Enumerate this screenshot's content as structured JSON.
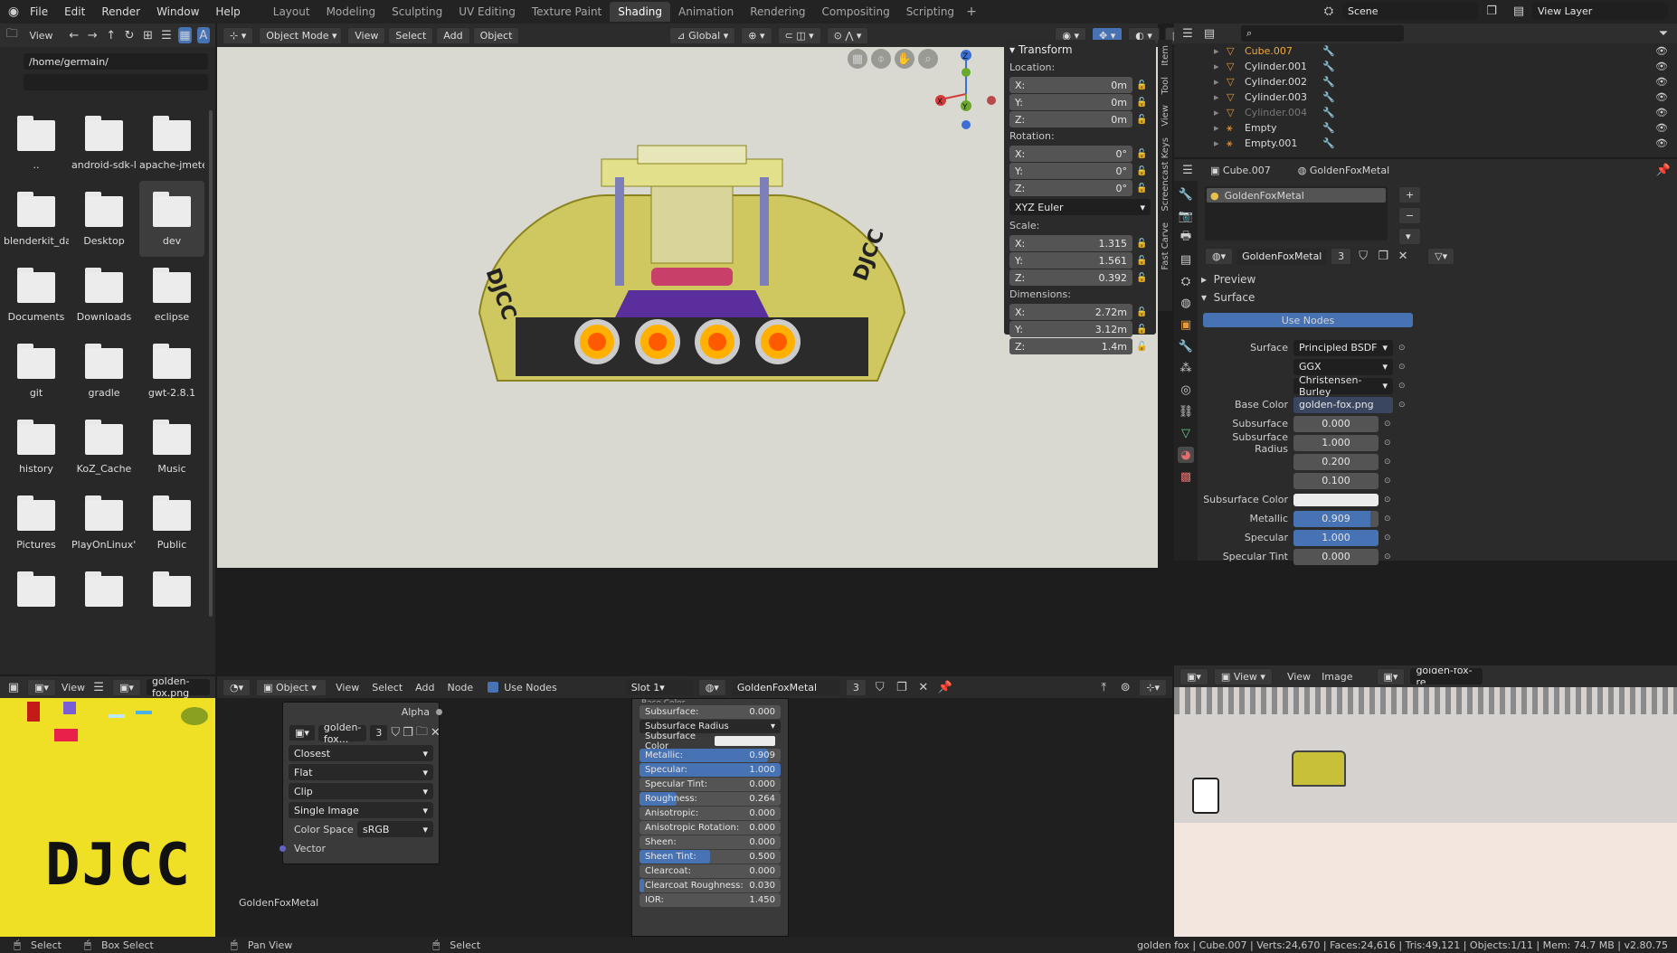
{
  "topbar": {
    "menus": [
      "File",
      "Edit",
      "Render",
      "Window",
      "Help"
    ],
    "workspaces": [
      "Layout",
      "Modeling",
      "Sculpting",
      "UV Editing",
      "Texture Paint",
      "Shading",
      "Animation",
      "Rendering",
      "Compositing",
      "Scripting"
    ],
    "active_workspace": "Shading",
    "add_tab": "+",
    "scene": "Scene",
    "view_layer": "View Layer"
  },
  "filebrowser": {
    "view_label": "View",
    "path": "/home/germain/",
    "filter": "",
    "items": [
      "..",
      "android-sdk-li...",
      "apache-jmete...",
      "blenderkit_data",
      "Desktop",
      "dev",
      "Documents",
      "Downloads",
      "eclipse",
      "git",
      "gradle",
      "gwt-2.8.1",
      "history",
      "KoZ_Cache",
      "Music",
      "Pictures",
      "PlayOnLinux'...",
      "Public",
      "",
      "",
      ""
    ]
  },
  "viewport": {
    "mode": "Object Mode",
    "menus": [
      "View",
      "Select",
      "Add",
      "Object"
    ],
    "orientation": "Global",
    "gizmo": {
      "z": "Z",
      "y": "Y",
      "x": "X"
    },
    "model_text": "DJCC"
  },
  "transform": {
    "title": "Transform",
    "location_label": "Location:",
    "location": [
      {
        "axis": "X:",
        "value": "0m"
      },
      {
        "axis": "Y:",
        "value": "0m"
      },
      {
        "axis": "Z:",
        "value": "0m"
      }
    ],
    "rotation_label": "Rotation:",
    "rotation": [
      {
        "axis": "X:",
        "value": "0°"
      },
      {
        "axis": "Y:",
        "value": "0°"
      },
      {
        "axis": "Z:",
        "value": "0°"
      }
    ],
    "rotation_mode": "XYZ Euler",
    "scale_label": "Scale:",
    "scale": [
      {
        "axis": "X:",
        "value": "1.315"
      },
      {
        "axis": "Y:",
        "value": "1.561"
      },
      {
        "axis": "Z:",
        "value": "0.392"
      }
    ],
    "dimensions_label": "Dimensions:",
    "dimensions": [
      {
        "axis": "X:",
        "value": "2.72m"
      },
      {
        "axis": "Y:",
        "value": "3.12m"
      },
      {
        "axis": "Z:",
        "value": "1.4m"
      }
    ]
  },
  "side_tabs": [
    "Item",
    "Tool",
    "View",
    "Screencast Keys",
    "Fast Carve"
  ],
  "outliner": {
    "items": [
      {
        "name": "Cube.007",
        "active": true
      },
      {
        "name": "Cylinder.001"
      },
      {
        "name": "Cylinder.002"
      },
      {
        "name": "Cylinder.003"
      },
      {
        "name": "Cylinder.004",
        "dim": true
      },
      {
        "name": "Empty"
      },
      {
        "name": "Empty.001"
      }
    ]
  },
  "properties": {
    "object": "Cube.007",
    "material": "GoldenFoxMetal",
    "slot_name": "GoldenFoxMetal",
    "mat_field": "GoldenFoxMetal",
    "users": "3",
    "preview": "Preview",
    "surface_section": "Surface",
    "use_nodes": "Use Nodes",
    "rows": [
      {
        "label": "Surface",
        "value": "Principled BSDF",
        "type": "dd"
      },
      {
        "label": "",
        "value": "GGX",
        "type": "dd"
      },
      {
        "label": "",
        "value": "Christensen-Burley",
        "type": "dd"
      },
      {
        "label": "Base Color",
        "value": "golden-fox.png",
        "type": "link"
      },
      {
        "label": "Subsurface",
        "value": "0.000",
        "type": "num"
      },
      {
        "label": "Subsurface Radius",
        "value": "1.000",
        "type": "num"
      },
      {
        "label": "",
        "value": "0.200",
        "type": "num"
      },
      {
        "label": "",
        "value": "0.100",
        "type": "num"
      },
      {
        "label": "Subsurface Color",
        "value": "",
        "type": "color"
      },
      {
        "label": "Metallic",
        "value": "0.909",
        "type": "bar",
        "fill": 0.909
      },
      {
        "label": "Specular",
        "value": "1.000",
        "type": "bar",
        "fill": 1.0
      },
      {
        "label": "Specular Tint",
        "value": "0.000",
        "type": "num"
      }
    ]
  },
  "image_editor": {
    "view_label": "View",
    "image_name": "golden-fox.png",
    "text": "DJCC"
  },
  "node_editor": {
    "type": "Object",
    "menus": [
      "View",
      "Select",
      "Add",
      "Node"
    ],
    "use_nodes": "Use Nodes",
    "slot": "Slot 1",
    "material": "GoldenFoxMetal",
    "users": "3",
    "frame_label": "GoldenFoxMetal",
    "image_node": {
      "alpha": "Alpha",
      "image": "golden-fox...",
      "users": "3",
      "interp": "Closest",
      "proj": "Flat",
      "ext": "Clip",
      "source": "Single Image",
      "colorspace_label": "Color Space",
      "colorspace": "sRGB",
      "vector": "Vector"
    },
    "bsdf_top": "Base Color",
    "bsdf_rows": [
      {
        "label": "Subsurface:",
        "value": "0.000",
        "fill": 0
      },
      {
        "label": "Subsurface Radius",
        "value": "",
        "type": "dd"
      },
      {
        "label": "Subsurface Color",
        "value": "",
        "type": "color"
      },
      {
        "label": "Metallic:",
        "value": "0.909",
        "fill": 0.909
      },
      {
        "label": "Specular:",
        "value": "1.000",
        "fill": 1.0
      },
      {
        "label": "Specular Tint:",
        "value": "0.000",
        "fill": 0
      },
      {
        "label": "Roughness:",
        "value": "0.264",
        "fill": 0.264
      },
      {
        "label": "Anisotropic:",
        "value": "0.000",
        "fill": 0
      },
      {
        "label": "Anisotropic Rotation:",
        "value": "0.000",
        "fill": 0
      },
      {
        "label": "Sheen:",
        "value": "0.000",
        "fill": 0
      },
      {
        "label": "Sheen Tint:",
        "value": "0.500",
        "fill": 0.5
      },
      {
        "label": "Clearcoat:",
        "value": "0.000",
        "fill": 0
      },
      {
        "label": "Clearcoat Roughness:",
        "value": "0.030",
        "fill": 0.03
      },
      {
        "label": "IOR:",
        "value": "1.450",
        "fill": 0
      }
    ]
  },
  "render_preview": {
    "view_label": "View",
    "menus": [
      "View",
      "Image"
    ],
    "image_name": "golden-fox-re"
  },
  "statusbar": {
    "select": "Select",
    "box_select": "Box Select",
    "pan_view": "Pan View",
    "select2": "Select",
    "info": "golden fox | Cube.007 | Verts:24,670 | Faces:24,616 | Tris:49,121 | Objects:1/11 | Mem: 74.7 MB | v2.80.75"
  },
  "colors": {
    "accent": "#4772b3",
    "active_tab": "#3d3d3d",
    "viewport_bg": "#d9d8d1",
    "car": "#d6d06a"
  }
}
